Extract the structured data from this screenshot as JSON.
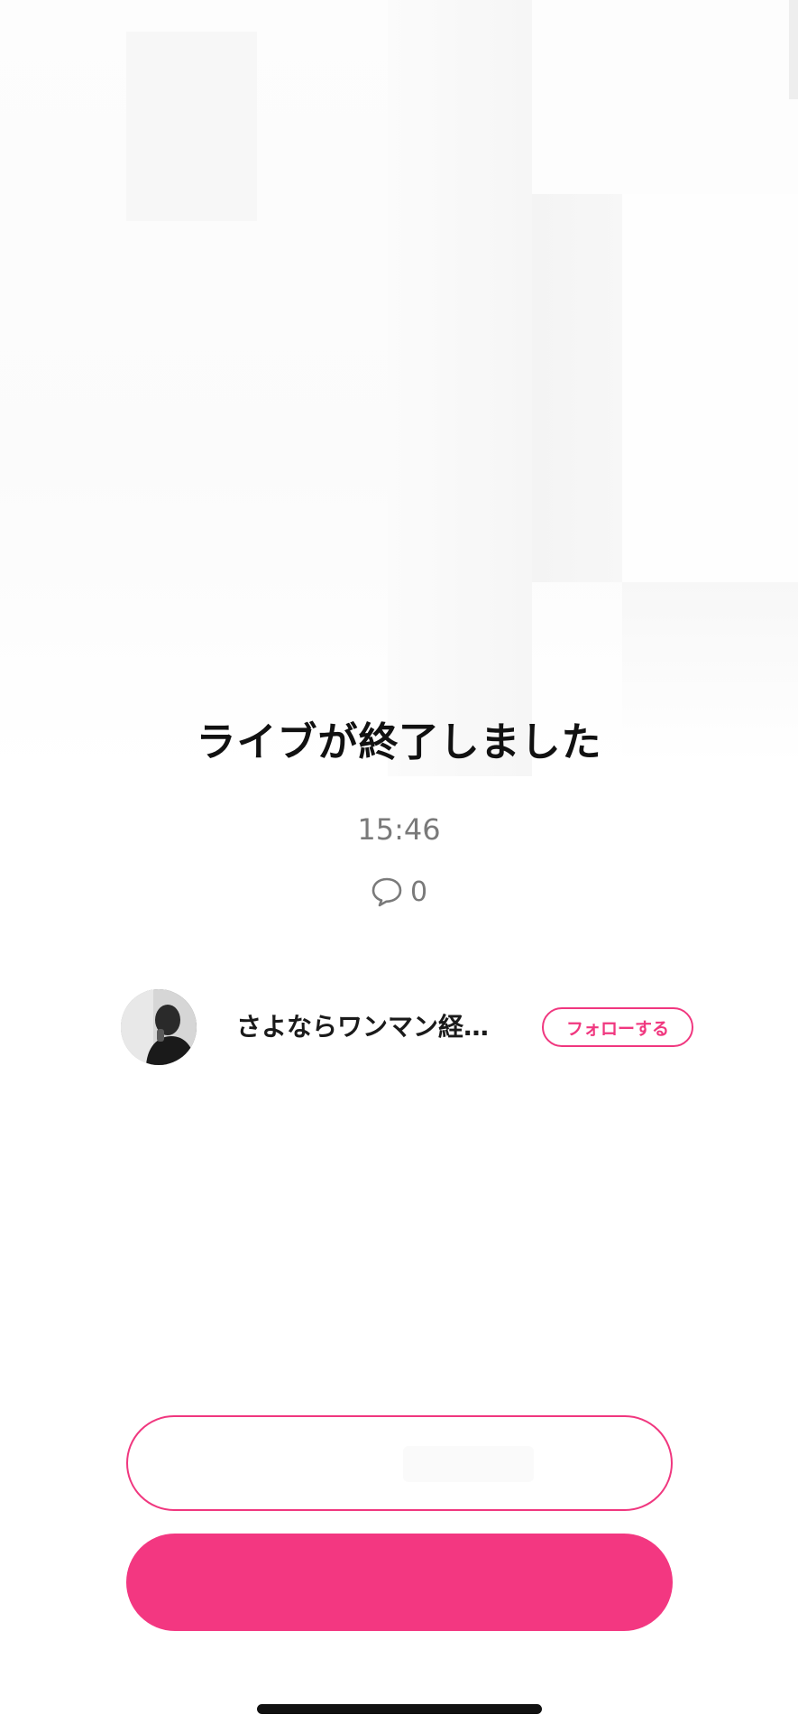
{
  "live_end": {
    "title": "ライブが終了しました",
    "duration": "15:46",
    "comment_count": "0"
  },
  "host": {
    "name": "さよならワンマン経…",
    "follow_label": "フォローする"
  },
  "colors": {
    "accent": "#f33781",
    "text": "#111111",
    "muted": "#7a7a7a"
  },
  "icons": {
    "comment": "speech-bubble-icon"
  }
}
